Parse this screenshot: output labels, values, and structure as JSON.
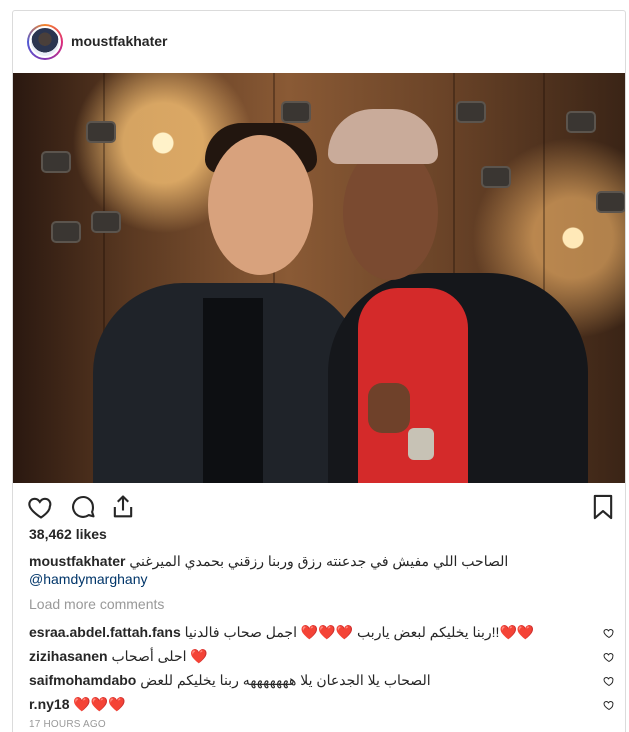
{
  "post": {
    "username": "moustfakhater",
    "likes": "38,462 likes",
    "caption_username": "moustfakhater",
    "caption_text": "الصاحب اللي مفيش في جدعنته رزق وربنا رزقني بحمدي الميرغني",
    "caption_mention": "@hamdymarghany",
    "load_more": "Load more comments",
    "timestamp": "17 HOURS AGO"
  },
  "comments": [
    {
      "username": "esraa.abdel.fattah.fans",
      "text": "ربنا يخليكم لبعض ياربب ❤️❤️❤️ اجمل صحاب فالدنيا!!❤️❤️"
    },
    {
      "username": "zizihasanen",
      "text": "احلى أصحاب ❤️"
    },
    {
      "username": "saifmohamdabo",
      "text": "الصحاب يلا الجدعان يلا هههههههه ربنا يخليكم للعض"
    },
    {
      "username": "r.ny18",
      "text": "❤️❤️❤️"
    }
  ],
  "icons": {
    "like": "heart-icon",
    "comment": "comment-bubble-icon",
    "share": "share-icon",
    "save": "bookmark-icon"
  },
  "colors": {
    "mention": "#003569",
    "meta": "#999999",
    "text": "#262626"
  }
}
